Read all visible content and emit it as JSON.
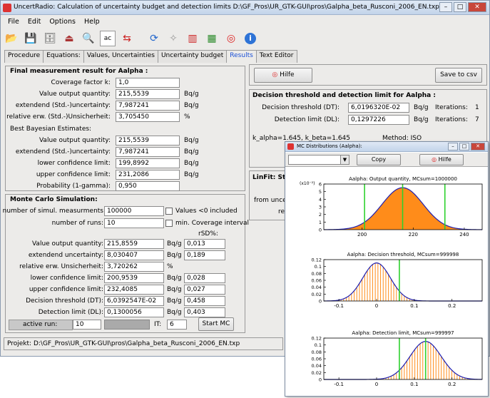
{
  "window": {
    "title": "UncertRadio: Calculation of uncertainty budget and detection limits    D:\\GF_Pros\\UR_GTK-GUI\\pros\\Galpha_beta_Rusconi_2006_EN.txp"
  },
  "menu": [
    "File",
    "Edit",
    "Options",
    "Help"
  ],
  "tabs": [
    "Procedure",
    "Equations:",
    "Values, Uncertainties",
    "Uncertainty budget",
    "Results",
    "Text Editor"
  ],
  "final": {
    "header": "Final measurement result for Aalpha :",
    "coverage_label": "Coverage factor k:",
    "coverage_value": "1,0",
    "value_label": "Value output quantity:",
    "value_value": "215,5539",
    "value_unit": "Bq/g",
    "unc_label": "extendend (Std.-)uncertainty:",
    "unc_value": "7,987241",
    "unc_unit": "Bq/g",
    "rel_label": "relative erw. (Std.-)Unsicherheit:",
    "rel_value": "3,705450",
    "rel_unit": "%",
    "bayes_header": "Best Bayesian Estimates:",
    "b_value_label": "Value output quantity:",
    "b_value_value": "215,5539",
    "b_value_unit": "Bq/g",
    "b_unc_label": "extendend (Std.-)uncertainty:",
    "b_unc_value": "7,987241",
    "b_unc_unit": "Bq/g",
    "lcl_label": "lower confidence limit:",
    "lcl_value": "199,8992",
    "lcl_unit": "Bq/g",
    "ucl_label": "upper confidence limit:",
    "ucl_value": "231,2086",
    "ucl_unit": "Bq/g",
    "prob_label": "Probability (1-gamma):",
    "prob_value": "0,950"
  },
  "mcsim": {
    "header": "Monte Carlo Simulation:",
    "nsim_label": "number of simul. measurments",
    "nsim_value": "100000",
    "neg_label": "Values <0 included",
    "nruns_label": "number of runs:",
    "nruns_value": "10",
    "mincov_label": "min. Coverage interval",
    "rsd_header": "rSD%:",
    "rows": [
      {
        "label": "Value output quantity:",
        "value": "215,8559",
        "unit": "Bq/g",
        "rsd": "0,013"
      },
      {
        "label": "extendend uncertainty:",
        "value": "8,030407",
        "unit": "Bq/g",
        "rsd": "0,189"
      },
      {
        "label": "relative erw. Unsicherheit:",
        "value": "3,720262",
        "unit": "%",
        "rsd": ""
      },
      {
        "label": "lower confidence limit:",
        "value": "200,9539",
        "unit": "Bq/g",
        "rsd": "0,028"
      },
      {
        "label": "upper confidence limit:",
        "value": "232,4085",
        "unit": "Bq/g",
        "rsd": "0,027"
      },
      {
        "label": "Decision threshold (DT):",
        "value": "6,0392547E-02",
        "unit": "Bq/g",
        "rsd": "0,458"
      },
      {
        "label": "Detection limit (DL):",
        "value": "0,1300056",
        "unit": "Bq/g",
        "rsd": "0,403"
      }
    ],
    "active_run_label": "active run:",
    "active_run_value": "10",
    "it_label": "IT:",
    "it_value": "6",
    "start_label": "Start MC"
  },
  "right": {
    "hilfe_label": "Hilfe",
    "save_label": "Save to csv",
    "dt_header": "Decision threshold and detection limit for Aalpha :",
    "dt_label": "Decision threshold (DT):",
    "dt_value": "6,0196320E-02",
    "dt_unit": "Bq/g",
    "dt_iter_label": "Iterations:",
    "dt_iter_value": "1",
    "dl_label": "Detection limit (DL):",
    "dl_value": "0,1297226",
    "dl_unit": "Bq/g",
    "dl_iter_label": "Iterations:",
    "dl_iter_value": "7",
    "kalpha": "k_alpha=1.645,  k_beta=1.645",
    "method": "Method: ISO",
    "linfit": "LinFit: Sta",
    "from_uncert": "from uncert",
    "rec": "rec"
  },
  "status": "Projekt: D:\\GF_Pros\\UR_GTK-GUI\\pros\\Galpha_beta_Rusconi_2006_EN.txp",
  "mcwin": {
    "title": "MC Distributions (Aalpha):",
    "copy_label": "Copy",
    "hilfe_label": "Hilfe"
  },
  "chart_data": [
    {
      "type": "area",
      "title": "Aalpha:  Output quantity,  MCsum=1000000",
      "y_exponent_label": "(x10⁻²)",
      "xlim": [
        185,
        247
      ],
      "ylim": [
        0,
        6
      ],
      "xticks": [
        200,
        220,
        240
      ],
      "yticks": [
        0,
        1,
        2,
        3,
        4,
        5,
        6
      ],
      "mean": 215.86,
      "sigma": 8.03,
      "vlines": [
        200.95,
        215.86,
        232.41
      ],
      "fill_color": "#ff8c1a",
      "curve_color": "#1f1fb0",
      "vline_color": "#2ed12e"
    },
    {
      "type": "bar",
      "title": "Aalpha:  Decision threshold,  MCsum=999998",
      "xlim": [
        -0.14,
        0.28
      ],
      "ylim": [
        0,
        0.12
      ],
      "xticks": [
        -0.1,
        0.0,
        0.1,
        0.2
      ],
      "yticks": [
        0.0,
        0.02,
        0.04,
        0.06,
        0.08,
        0.1,
        0.12
      ],
      "mean": 0.0,
      "sigma": 0.0367,
      "vlines": [
        0.0604
      ],
      "bar_color": "#ff8c1a",
      "curve_color": "#1f1fb0",
      "vline_color": "#2ed12e"
    },
    {
      "type": "bar",
      "title": "Aalpha:  Detection limit,  MCsum=999997",
      "xlim": [
        -0.14,
        0.28
      ],
      "ylim": [
        0,
        0.12
      ],
      "xticks": [
        -0.1,
        0.0,
        0.1,
        0.2
      ],
      "yticks": [
        0.0,
        0.02,
        0.04,
        0.06,
        0.08,
        0.1,
        0.12
      ],
      "mean": 0.13,
      "sigma": 0.0414,
      "vlines": [
        0.0604,
        0.13
      ],
      "bar_color": "#ff8c1a",
      "curve_color": "#1f1fb0",
      "vline_color": "#2ed12e"
    }
  ]
}
